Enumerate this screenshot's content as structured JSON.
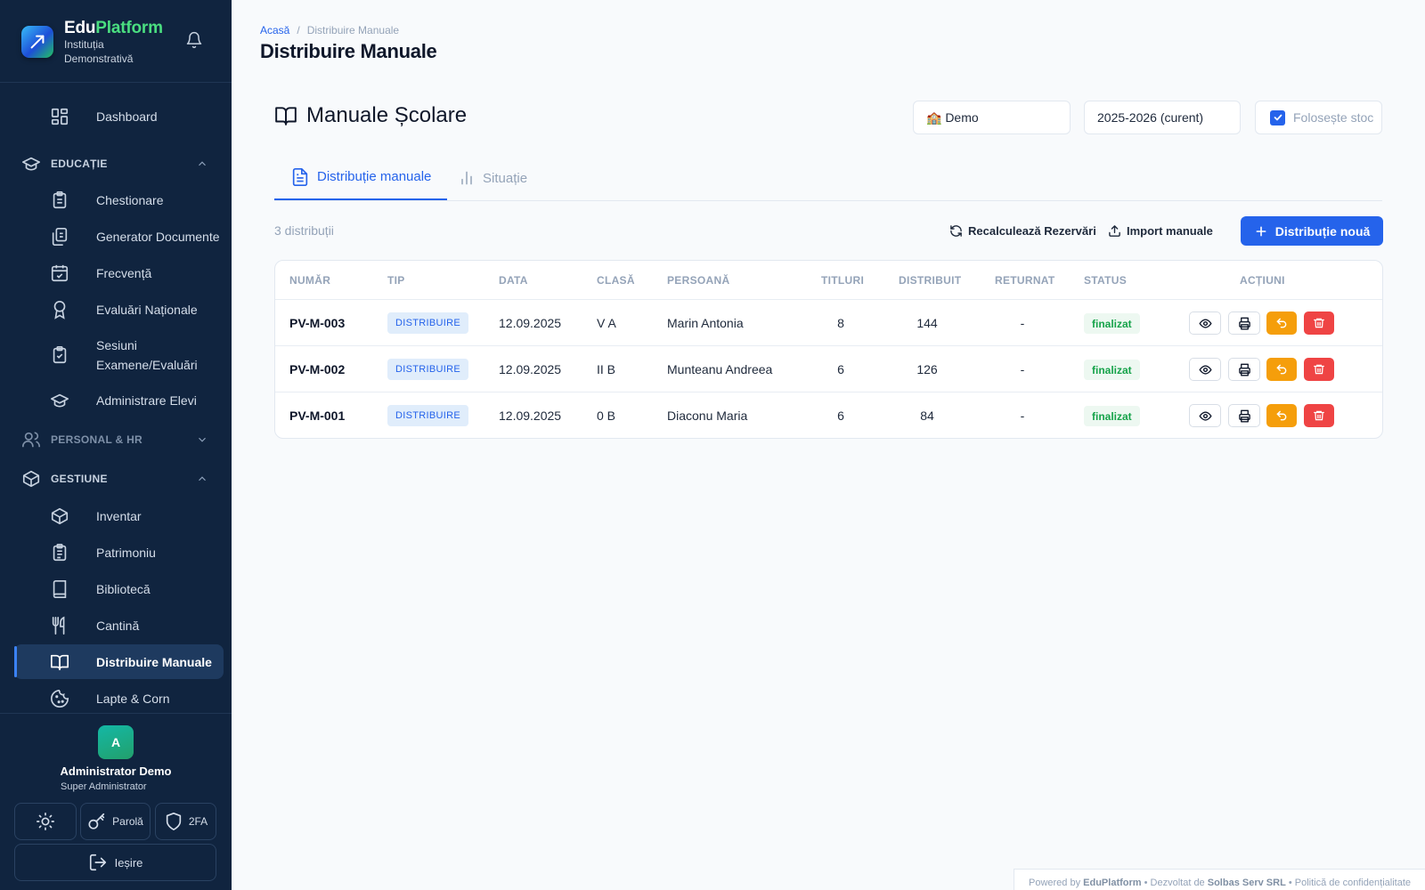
{
  "brand": {
    "name_part1": "Edu",
    "name_part2": "Platform",
    "institution": "Instituția Demonstrativă"
  },
  "sidebar": {
    "items": [
      {
        "label": "Dashboard",
        "icon": "dashboard-icon"
      },
      {
        "section": "EDUCAȚIE",
        "icon": "graduation-cap-icon",
        "expanded": true
      },
      {
        "label": "Chestionare",
        "icon": "clipboard-icon"
      },
      {
        "label": "Generator Documente",
        "icon": "documents-icon"
      },
      {
        "label": "Frecvență",
        "icon": "calendar-check-icon"
      },
      {
        "label": "Evaluări Naționale",
        "icon": "award-icon"
      },
      {
        "label": "Sesiuni Examene/Evaluări",
        "icon": "clipboard-check-icon"
      },
      {
        "label": "Administrare Elevi",
        "icon": "graduation-cap-icon"
      },
      {
        "section": "PERSONAL & HR",
        "icon": "users-icon",
        "expanded": false
      },
      {
        "section": "GESTIUNE",
        "icon": "box-icon",
        "expanded": true
      },
      {
        "label": "Inventar",
        "icon": "box-icon"
      },
      {
        "label": "Patrimoniu",
        "icon": "clipboard-list-icon"
      },
      {
        "label": "Bibliotecă",
        "icon": "book-icon"
      },
      {
        "label": "Cantină",
        "icon": "utensils-icon"
      },
      {
        "label": "Distribuire Manuale",
        "icon": "book-open-icon",
        "active": true
      },
      {
        "label": "Lapte & Corn",
        "icon": "cookie-icon"
      }
    ]
  },
  "user": {
    "initial": "A",
    "name": "Administrator Demo",
    "role": "Super Administrator",
    "password_label": "Parolă",
    "twofa_label": "2FA",
    "logout_label": "Ieșire"
  },
  "breadcrumb": {
    "home": "Acasă",
    "separator": "/",
    "current": "Distribuire Manuale"
  },
  "page_title": "Distribuire Manuale",
  "section_title": "Manuale Școlare",
  "filters": {
    "school": "🏫 Demo",
    "year": "2025-2026 (curent)",
    "use_stock_label": "Folosește stoc",
    "use_stock_checked": true
  },
  "tabs": [
    {
      "label": "Distribuție manuale",
      "icon": "file-text-icon",
      "active": true
    },
    {
      "label": "Situație",
      "icon": "bar-chart-icon",
      "active": false
    }
  ],
  "toolbar": {
    "count_text": "3 distribuții",
    "recalc_label": "Recalculează Rezervări",
    "import_label": "Import manuale",
    "new_label": "Distribuție nouă"
  },
  "table": {
    "headers": [
      "NUMĂR",
      "TIP",
      "DATA",
      "CLASĂ",
      "PERSOANĂ",
      "TITLURI",
      "DISTRIBUIT",
      "RETURNAT",
      "STATUS",
      "ACȚIUNI"
    ],
    "rows": [
      {
        "number": "PV-M-003",
        "type": "DISTRIBUIRE",
        "date": "12.09.2025",
        "class": "V A",
        "person": "Marin Antonia",
        "titles": "8",
        "distributed": "144",
        "returned": "-",
        "status": "finalizat"
      },
      {
        "number": "PV-M-002",
        "type": "DISTRIBUIRE",
        "date": "12.09.2025",
        "class": "II B",
        "person": "Munteanu Andreea",
        "titles": "6",
        "distributed": "126",
        "returned": "-",
        "status": "finalizat"
      },
      {
        "number": "PV-M-001",
        "type": "DISTRIBUIRE",
        "date": "12.09.2025",
        "class": "0 B",
        "person": "Diaconu Maria",
        "titles": "6",
        "distributed": "84",
        "returned": "-",
        "status": "finalizat"
      }
    ]
  },
  "footer": {
    "powered": "Powered by",
    "brand": "EduPlatform",
    "dev": "• Dezvoltat de",
    "company": "Solbas Serv SRL",
    "privacy": "• Politică de confidențialitate"
  },
  "colors": {
    "sidebar_bg": "#10243f",
    "accent": "#2563eb",
    "warning": "#f59e0b",
    "danger": "#ef4444",
    "success": "#16a34a"
  }
}
